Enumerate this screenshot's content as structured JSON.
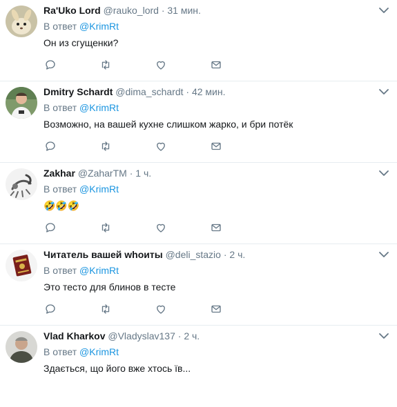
{
  "reply_prefix": "В ответ",
  "colors": {
    "link": "#1b95e0",
    "muted": "#657786",
    "text": "#14171a",
    "divider": "#e6ecf0"
  },
  "tweets": [
    {
      "name": "Ra'Uko Lord",
      "handle": "@rauko_lord",
      "dot": "·",
      "time": "31 мин.",
      "reply_prefix": "В ответ",
      "mention": "@KrimRt",
      "text": "Он из сгущенки?"
    },
    {
      "name": "Dmitry Schardt",
      "handle": "@dima_schardt",
      "dot": "·",
      "time": "42 мин.",
      "reply_prefix": "В ответ",
      "mention": "@KrimRt",
      "text": "Возможно, на вашей кухне слишком жарко, и бри потёк"
    },
    {
      "name": "Zakhar",
      "handle": "@ZaharTM",
      "dot": "·",
      "time": "1 ч.",
      "reply_prefix": "В ответ",
      "mention": "@KrimRt",
      "text": "🤣🤣🤣"
    },
    {
      "name": "Читатель вашей whoиты",
      "handle": "@deli_stazio",
      "dot": "·",
      "time": "2 ч.",
      "reply_prefix": "В ответ",
      "mention": "@KrimRt",
      "text": "Это тесто для блинов в тесте"
    },
    {
      "name": "Vlad Kharkov",
      "handle": "@Vladyslav137",
      "dot": "·",
      "time": "2 ч.",
      "reply_prefix": "В ответ",
      "mention": "@KrimRt",
      "text": "Здається, що його вже хтось їв..."
    }
  ]
}
